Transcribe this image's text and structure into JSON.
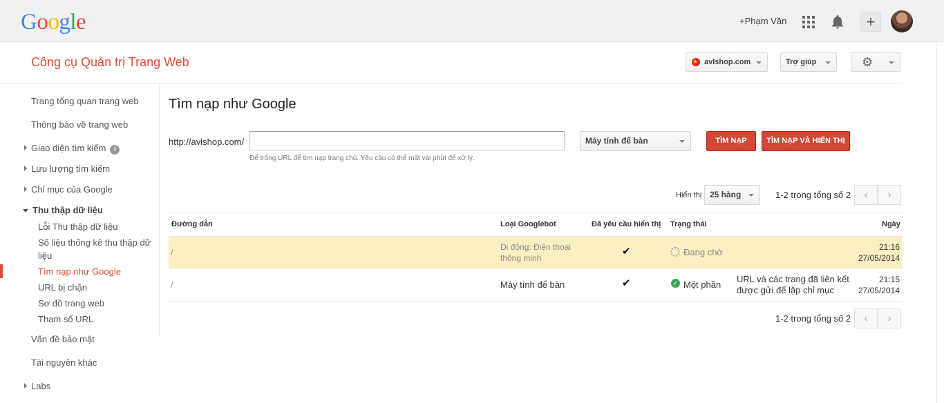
{
  "gbar": {
    "logo": "Google",
    "user_name": "+Phạm Văn"
  },
  "header": {
    "product_title": "Công cụ Quản trị Trang Web",
    "site": "avlshop.com",
    "help": "Trợ giúp"
  },
  "sidebar": {
    "items": [
      "Trang tổng quan trang web",
      "Thông báo về trang web",
      "Giao diện tìm kiếm",
      "Lưu lượng tìm kiếm",
      "Chỉ mục của Google",
      "Thu thập dữ liệu",
      "Lỗi Thu thập dữ liệu",
      "Số liệu thống kê thu thập dữ",
      "liệu",
      "Tìm nạp như Google",
      "URL bị chặn",
      "Sơ đồ trang web",
      "Tham số URL",
      "Vấn đề bảo mật",
      "Tài nguyên khác",
      "Labs"
    ]
  },
  "main": {
    "title": "Tìm nạp như Google",
    "url_prefix": "http://avlshop.com/",
    "url_value": "",
    "url_hint": "Để trống URL để tìm nạp trang chủ. Yêu cầu có thể mất vài phút để xử lý.",
    "device": "Máy tính để bàn",
    "fetch_label": "TÌM NẠP",
    "fetch_render_label": "TÌM NẠP VÀ HIỂN THỊ",
    "show_label": "Hiển thị",
    "rows_per_page": "25 hàng",
    "pagination": "1-2 trong tổng số 2"
  },
  "table": {
    "headers": [
      "Đường dẫn",
      "Loại Googlebot",
      "Đã yêu cầu hiển thị",
      "Trạng thái",
      "Ngày"
    ],
    "rows": [
      {
        "path": "/",
        "bot_line1": "Di động: Điện thoại",
        "bot_line2": "thông minh",
        "render": "✔",
        "status": "Đang chờ",
        "note_line1": "",
        "note_line2": "",
        "time": "21:16",
        "date": "27/05/2014"
      },
      {
        "path": "/",
        "bot_line1": "Máy tính để bàn",
        "bot_line2": "",
        "render": "✔",
        "status": "Một phần",
        "note_line1": "URL và các trang đã liên kết",
        "note_line2": "được gửi để lập chỉ mục",
        "time": "21:15",
        "date": "27/05/2014"
      }
    ]
  },
  "colors": {
    "brand_red": "#dd4b39",
    "button_red": "#d14836",
    "pending_row": "#fcf0c2",
    "success_green": "#3aa757"
  }
}
